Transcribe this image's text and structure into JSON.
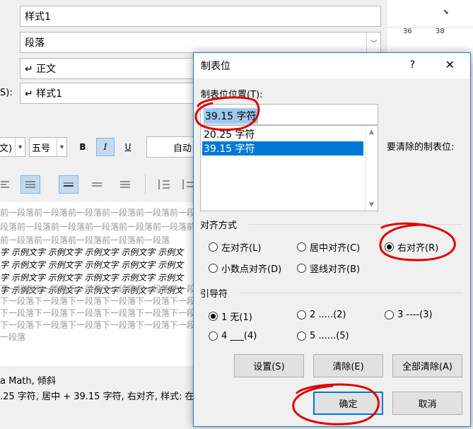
{
  "background_panel": {
    "style_name_value": "样式1",
    "style_type_value": "段落",
    "based_on_value": "↵ 正文",
    "next_label_fragment": "S):",
    "next_style_value": "↵ 样式1",
    "font_fragment": "文)",
    "size_value": "五号",
    "bold": "B",
    "italic": "I",
    "underline": "U",
    "color_value": "自动",
    "ruler_marks": [
      "36",
      "38"
    ],
    "preview": {
      "prev_lines": [
        "前一段落前一段落前一段落前一段落前一段落前一段落前一",
        "段落前一段落前一段落前一段落前一段落前一段落前一段",
        "前一段落前一段落前一段落前一段落前一段落"
      ],
      "example_lines": [
        "字  示例文字  示例文字  示例文字  示例文字  示例文",
        "字  示例文字  示例文字  示例文字  示例文字  示例文",
        "字  示例文字  示例文字  示例文字  示例文字  示例文",
        "字  示例文字  示例文字  示例文字  示例文字  示例文"
      ],
      "next_lines": [
        "下一段落下一段落下一段落下一段落下一段落下一段落下一",
        "下一段落下一段落下一段落下一段落下一段落下一段落下一",
        "下一段落下一段落下一段落下一段落下一段落下一段落下一",
        "下一段落下一段落下一段落下一段落下一段落下一段落下一",
        "一段落"
      ]
    },
    "description_line1": "a Math, 倾斜",
    "description_line2": ".25 字符, 居中 +   39.15 字符, 右对齐, 样式: 在"
  },
  "dialog": {
    "title": "制表位",
    "help": "?",
    "close": "✕",
    "tab_position_label": "制表位位置(T):",
    "tab_position_value": "39.15 字符",
    "tab_list": [
      "20.25 字符",
      "39.15 字符"
    ],
    "selected_index": 1,
    "to_clear_label": "要清除的制表位:",
    "alignment": {
      "heading": "对齐方式",
      "options": [
        "左对齐(L)",
        "居中对齐(C)",
        "右对齐(R)",
        "小数点对齐(D)",
        "竖线对齐(B)"
      ],
      "selected": "右对齐(R)"
    },
    "leader": {
      "heading": "引导符",
      "options": [
        "1 无(1)",
        "2 .....(2)",
        "3 ----(3)",
        "4 ___(4)",
        "5 ......(5)"
      ],
      "selected": "1 无(1)"
    },
    "buttons": {
      "set": "设置(S)",
      "clear": "清除(E)",
      "clear_all": "全部清除(A)",
      "ok": "确定",
      "cancel": "取消"
    }
  },
  "colors": {
    "accent": "#0078d7",
    "annotation_red": "#e00000",
    "selection": "#9ec8f0"
  }
}
